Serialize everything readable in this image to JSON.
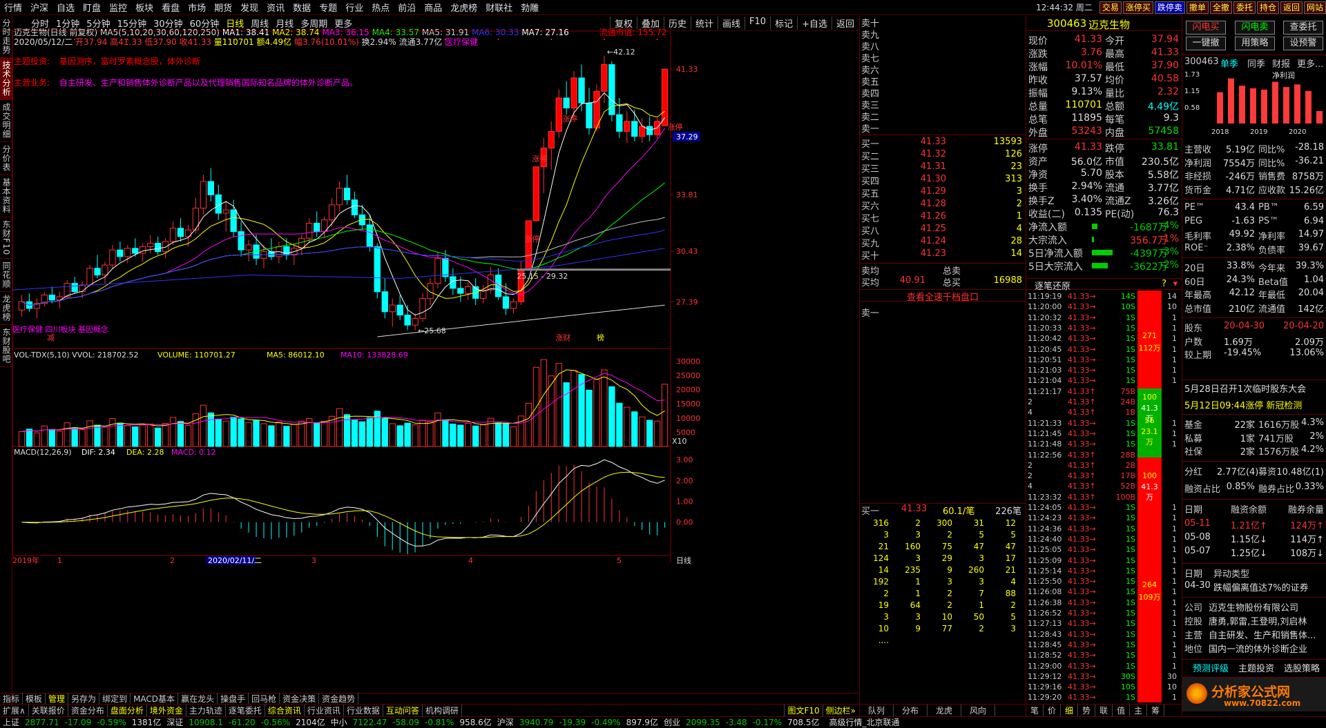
{
  "menu": [
    "行情",
    "沪深",
    "自选",
    "盯盘",
    "监控",
    "板块",
    "看盘",
    "市场",
    "期货",
    "发现",
    "资讯",
    "数据",
    "专题",
    "行业",
    "热点",
    "前沿",
    "商品",
    "龙虎榜",
    "财联社",
    "勃雕"
  ],
  "clock": "12:44:32 周二",
  "top_buttons": [
    "交易",
    "涨停买",
    "跌停卖",
    "撤单",
    "全撤",
    "委托",
    "持仓",
    "返回",
    "网站"
  ],
  "toolbar": {
    "periods": [
      "分时",
      "1分钟",
      "5分钟",
      "15分钟",
      "30分钟",
      "60分钟",
      "日线",
      "周线",
      "月线",
      "多周期",
      "更多"
    ],
    "active": "日线",
    "right": [
      "复权",
      "叠加",
      "历史",
      "统计",
      "画线",
      "F10",
      "标记",
      "+自选",
      "返回"
    ]
  },
  "left_tabs": [
    "分时走势",
    "技术分析",
    "成交明细",
    "分价表",
    "基本资料",
    "东财F10",
    "同花顺",
    "龙虎榜",
    "东财股吧"
  ],
  "active_left_tab": "技术分析",
  "info": {
    "name": "迈克生物(日线 前复权)",
    "ma_label": "MA5(5,10,20,30,60,120,250)",
    "ma1": "MA1: 38.41",
    "ma2": "MA2: 38.74",
    "ma3": "MA3: 36.15",
    "ma4": "MA4: 33.57",
    "ma5": "MA5: 31.91",
    "ma6": "MA6: 30.33",
    "ma7": "MA7: 27.16",
    "float_cap": "流通市值: 155.72",
    "date_line": "2020/05/12/二",
    "open": "开37.94",
    "high": "高41.33",
    "low": "低37.90",
    "close": "收41.33",
    "vol": "量110701",
    "amt": "额4.49亿",
    "chg": "幅3.76(10.01%)",
    "turn": "换2.94%",
    "float": "流通3.77亿",
    "sector": "医疗保健",
    "theme_label": "主题投资:",
    "theme_text": "基因测序，富时罗素概念股，体外诊断",
    "biz_label": "主营业务:",
    "biz_text": "自主研发、生产和销售体外诊断产品以及代理销售国际知名品牌的体外诊断产品。"
  },
  "price_axis": [
    "41.33",
    "37.29",
    "33.81",
    "30.43",
    "27.39"
  ],
  "chart_annotations": {
    "high": "42.12",
    "low": "25.68",
    "mid": "25.15 - 29.32",
    "zt1": "涨停",
    "zt2": "涨停",
    "zt3": "涨停",
    "zt4": "涨停",
    "bottom_tags": [
      "医疗保健",
      "四川板块",
      "基因概念"
    ],
    "mark1": "减",
    "mark2": "涨财",
    "mark3": "榜"
  },
  "vol_info": {
    "label": "VOL-TDX(5,10)",
    "vvol": "VVOL: 218702.52",
    "volume": "VOLUME: 110701.27",
    "ma5": "MA5: 86012.10",
    "ma10": "MA10: 133828.69"
  },
  "vol_axis": [
    "30000",
    "25000",
    "20000",
    "15000",
    "10000",
    "5000",
    "X10"
  ],
  "macd_info": {
    "label": "MACD(12,26,9)",
    "dif": "DIF: 2.34",
    "dea": "DEA: 2.28",
    "macd": "MACD: 0.12"
  },
  "macd_axis": [
    "3.00",
    "2.00",
    "1.00",
    "0.00"
  ],
  "x_labels": [
    "2019年",
    "1",
    "2",
    "2020/02/11/二",
    "3",
    "4",
    "5"
  ],
  "x_right": "日线",
  "bottom_tabs1": [
    "指标",
    "模板",
    "管理",
    "另存为",
    "绑定到",
    "MACD基本",
    "赢在龙头",
    "操盘手",
    "回马枪",
    "资金决策",
    "资金趋势"
  ],
  "bottom_tabs2": [
    "扩展∧",
    "关联报价",
    "资金分布",
    "盘面分析",
    "境外资金",
    "主力轨迹",
    "逐笔委托",
    "综合资讯",
    "行业资讯",
    "行业数据",
    "互动问答",
    "机构调研"
  ],
  "bottom_right": [
    "图文F10",
    "侧边栏»"
  ],
  "status": [
    {
      "k": "上证",
      "v": "2877.71",
      "c": "-17.09",
      "p": "-0.59%",
      "a": "1381亿"
    },
    {
      "k": "深证",
      "v": "10908.1",
      "c": "-61.20",
      "p": "-0.56%",
      "a": "2104亿"
    },
    {
      "k": "中小",
      "v": "7122.47",
      "c": "-58.09",
      "p": "-0.81%",
      "a": "958.6亿"
    },
    {
      "k": "沪深",
      "v": "3940.79",
      "c": "-19.39",
      "p": "-0.49%",
      "a": "897.9亿"
    },
    {
      "k": "创业",
      "v": "2099.35",
      "c": "-3.48",
      "p": "-0.17%",
      "a": "708.5亿"
    }
  ],
  "status_tail": "高级行情_北京联通",
  "orderbook": {
    "sells": [
      "卖十",
      "卖九",
      "卖八",
      "卖七",
      "卖六",
      "卖五",
      "卖四",
      "卖三",
      "卖二",
      "卖一"
    ],
    "buys": [
      {
        "l": "买一",
        "p": "41.33",
        "v": "13593"
      },
      {
        "l": "买二",
        "p": "41.32",
        "v": "126"
      },
      {
        "l": "买三",
        "p": "41.31",
        "v": "23"
      },
      {
        "l": "买四",
        "p": "41.30",
        "v": "313"
      },
      {
        "l": "买五",
        "p": "41.29",
        "v": "3"
      },
      {
        "l": "买六",
        "p": "41.28",
        "v": "2"
      },
      {
        "l": "买七",
        "p": "41.26",
        "v": "1"
      },
      {
        "l": "买八",
        "p": "41.25",
        "v": "4"
      },
      {
        "l": "买九",
        "p": "41.24",
        "v": "28"
      },
      {
        "l": "买十",
        "p": "41.23",
        "v": "14"
      }
    ],
    "sell_avg": "卖均",
    "buy_avg": "买均",
    "total_sell": "总卖",
    "total_buy": "总买",
    "buy_avg_val": "40.91",
    "total_buy_val": "16988",
    "link": "查看全速千档盘口",
    "sell1": "卖一",
    "buy1_row": {
      "l": "买一",
      "p": "41.33",
      "q": "60.1/笔",
      "n": "226笔"
    },
    "queue": [
      [
        "316",
        "2",
        "300",
        "31",
        "12"
      ],
      [
        "3",
        "3",
        "2",
        "5",
        "5"
      ],
      [
        "21",
        "160",
        "75",
        "47",
        "47"
      ],
      [
        "124",
        "3",
        "29",
        "3",
        "17"
      ],
      [
        "14",
        "235",
        "9",
        "260",
        "21"
      ],
      [
        "192",
        "1",
        "3",
        "3",
        "4"
      ],
      [
        "2",
        "1",
        "2",
        "7",
        "88"
      ],
      [
        "19",
        "64",
        "2",
        "1",
        "2"
      ],
      [
        "3",
        "3",
        "10",
        "50",
        "5"
      ],
      [
        "10",
        "9",
        "77",
        "2",
        "3"
      ],
      [
        "....",
        "",
        "",
        "",
        ""
      ]
    ],
    "bottom_tabs": [
      "队列",
      "分布",
      "龙虎",
      "风向"
    ]
  },
  "quote": {
    "code": "300463",
    "name": "迈克生物",
    "rows": [
      {
        "a": "现价",
        "b": "41.33",
        "bc": "up",
        "c": "今开",
        "d": "37.94",
        "dc": "up"
      },
      {
        "a": "涨跌",
        "b": "3.76",
        "bc": "up",
        "c": "最高",
        "d": "41.33",
        "dc": "up"
      },
      {
        "a": "涨幅",
        "b": "10.01%",
        "bc": "up",
        "c": "最低",
        "d": "37.90",
        "dc": "up"
      },
      {
        "a": "昨收",
        "b": "37.57",
        "bc": "wh",
        "c": "均价",
        "d": "40.58",
        "dc": "up"
      },
      {
        "a": "振幅",
        "b": "9.13%",
        "bc": "wh",
        "c": "量比",
        "d": "2.32",
        "dc": "up"
      },
      {
        "a": "总量",
        "b": "110701",
        "bc": "yel",
        "c": "总额",
        "d": "4.49亿",
        "dc": "cy"
      },
      {
        "a": "总笔",
        "b": "11895",
        "bc": "wh",
        "c": "每笔",
        "d": "9.3",
        "dc": "wh"
      },
      {
        "a": "外盘",
        "b": "53243",
        "bc": "up",
        "c": "内盘",
        "d": "57458",
        "dc": "dn"
      },
      {
        "a": "涨停",
        "b": "41.33",
        "bc": "up",
        "c": "跌停",
        "d": "33.81",
        "dc": "dn"
      },
      {
        "a": "资产",
        "b": "56.0亿",
        "bc": "wh",
        "c": "市值",
        "d": "230.5亿",
        "dc": "wh"
      },
      {
        "a": "净资",
        "b": "5.70",
        "bc": "wh",
        "c": "股本",
        "d": "5.58亿",
        "dc": "wh"
      },
      {
        "a": "换手",
        "b": "2.94%",
        "bc": "wh",
        "c": "流通",
        "d": "3.77亿",
        "dc": "wh"
      },
      {
        "a": "换手Z",
        "b": "3.40%",
        "bc": "wh",
        "c": "流通Z",
        "d": "3.26亿",
        "dc": "wh"
      },
      {
        "a": "收益(二)",
        "b": "0.135",
        "bc": "wh",
        "c": "PE(动)",
        "d": "76.3",
        "dc": "wh"
      }
    ],
    "flows": [
      {
        "a": "净流入额",
        "b": "-1687万",
        "d": "-4%",
        "bar": 0.15
      },
      {
        "a": "大宗流入",
        "b": "356.7万",
        "d": "1%",
        "bar": 0.05
      },
      {
        "a": "5日净流入额",
        "b": "-4397万",
        "d": "-3%",
        "bar": 0.6
      },
      {
        "a": "5日大宗流入",
        "b": "-3622万",
        "d": "-2%",
        "bar": 0.45
      }
    ],
    "tick_title": "逐笔还原",
    "ticks": [
      {
        "t": "11:19:19",
        "v": "14S",
        "n": "14"
      },
      {
        "t": "11:20:00",
        "v": "10S",
        "n": "10"
      },
      {
        "t": "11:20:32",
        "v": "1S",
        "n": "1"
      },
      {
        "t": "11:20:33",
        "v": "1S",
        "n": "1"
      },
      {
        "t": "11:20:42",
        "v": "1S",
        "n": "1"
      },
      {
        "t": "11:20:45",
        "v": "1S",
        "n": "1"
      },
      {
        "t": "11:20:51",
        "v": "1S",
        "n": "1"
      },
      {
        "t": "11:21:03",
        "v": "1S",
        "n": "1"
      },
      {
        "t": "11:21:04",
        "v": "1S",
        "n": "1"
      },
      {
        "t": "11:21:17",
        "v": "75B",
        "n": ""
      },
      {
        "t": "2",
        "v": "24B",
        "n": ""
      },
      {
        "t": "4",
        "v": "1B",
        "n": ""
      },
      {
        "t": "11:21:33",
        "v": "1S",
        "n": "1"
      },
      {
        "t": "11:21:45",
        "v": "1S",
        "n": "1"
      },
      {
        "t": "11:21:48",
        "v": "1S",
        "n": "1"
      },
      {
        "t": "11:22:56",
        "v": "28B",
        "n": ""
      },
      {
        "t": "2",
        "v": "2B",
        "n": ""
      },
      {
        "t": "2",
        "v": "17B",
        "n": ""
      },
      {
        "t": "4",
        "v": "52B",
        "n": ""
      },
      {
        "t": "11:23:32",
        "v": "100B",
        "n": ""
      },
      {
        "t": "11:24:05",
        "v": "1S",
        "n": "1"
      },
      {
        "t": "11:24:23",
        "v": "1S",
        "n": "1"
      },
      {
        "t": "11:24:36",
        "v": "1S",
        "n": "1"
      },
      {
        "t": "11:24:40",
        "v": "1S",
        "n": "1"
      },
      {
        "t": "11:25:05",
        "v": "1S",
        "n": "1"
      },
      {
        "t": "11:25:09",
        "v": "1S",
        "n": "1"
      },
      {
        "t": "11:25:14",
        "v": "1S",
        "n": "1"
      },
      {
        "t": "11:25:50",
        "v": "1S",
        "n": "1"
      },
      {
        "t": "11:26:08",
        "v": "1S",
        "n": "1"
      },
      {
        "t": "11:26:38",
        "v": "1S",
        "n": "1"
      },
      {
        "t": "11:26:52",
        "v": "1S",
        "n": "1"
      },
      {
        "t": "11:27:13",
        "v": "1S",
        "n": "1"
      },
      {
        "t": "11:28:43",
        "v": "1S",
        "n": "1"
      },
      {
        "t": "11:28:45",
        "v": "1S",
        "n": "1"
      },
      {
        "t": "11:28:52",
        "v": "1S",
        "n": "1"
      },
      {
        "t": "11:29:00",
        "v": "1S",
        "n": "1"
      },
      {
        "t": "11:29:12",
        "v": "30S",
        "n": "30"
      },
      {
        "t": "11:29:16",
        "v": "10S",
        "n": "10"
      },
      {
        "t": "11:29:20",
        "v": "1S",
        "n": "1"
      }
    ],
    "tick_price": "41.33",
    "tick_marks": [
      "271",
      "112万",
      "100",
      "41.3万",
      "56",
      "23.1万",
      "100",
      "41.3万",
      "264",
      "109万"
    ],
    "bottom_tabs": [
      "笔",
      "价",
      "细",
      "势",
      "联",
      "值",
      "主",
      "筹"
    ]
  },
  "fin": {
    "buttons": [
      "闪电买",
      "闪电卖",
      "查委托",
      "一键撤",
      "用策略",
      "设预警"
    ],
    "tabs": {
      "code": "300463",
      "t1": "单季",
      "t2": "同季",
      "t3": "财报",
      "t4": "更多..."
    },
    "chart_data": {
      "type": "bar",
      "categories": [
        "2018",
        "2019",
        "2020"
      ],
      "title": "净利润",
      "values": [
        1.2,
        1.73,
        1.45,
        1.35,
        1.3,
        1.6,
        1.4,
        1.5,
        1.25,
        0.48
      ],
      "ylabels": [
        "1.73",
        "1.15",
        "0.58"
      ],
      "xlabels": [
        "2018",
        "2019",
        "2020"
      ]
    },
    "rows1": [
      {
        "a": "主营收",
        "b": "5.19亿",
        "c": "同比%",
        "d": "-28.18"
      },
      {
        "a": "净利润",
        "b": "7554万",
        "c": "同比%",
        "d": "-36.21"
      },
      {
        "a": "非经损",
        "b": "-246万",
        "c": "销售费",
        "d": "8758万"
      },
      {
        "a": "货币金",
        "b": "4.71亿",
        "c": "应收款",
        "d": "15.26亿"
      }
    ],
    "rows2": [
      {
        "a": "PE™",
        "b": "43.4",
        "c": "PB™",
        "d": "6.59"
      },
      {
        "a": "PEG",
        "b": "-1.63",
        "c": "PS™",
        "d": "6.94"
      },
      {
        "a": "毛利率",
        "b": "49.92",
        "c": "净利率",
        "d": "14.97"
      },
      {
        "a": "ROE⁻",
        "b": "2.38%",
        "c": "负债率",
        "d": "39.67"
      }
    ],
    "rows3": [
      {
        "a": "20日",
        "b": "33.8%",
        "c": "今年来",
        "d": "39.3%"
      },
      {
        "a": "60日",
        "b": "24.3%",
        "c": "Beta值",
        "d": "1.04"
      },
      {
        "a": "年最高",
        "b": "42.12",
        "c": "年最低",
        "d": "20.04"
      },
      {
        "a": "总市值",
        "b": "210亿",
        "c": "流通值",
        "d": "142亿"
      }
    ],
    "holders": [
      {
        "a": "股东",
        "b": "20-04-30",
        "d": "20-04-20",
        "bc": "up",
        "dc": "up"
      },
      {
        "a": "户数",
        "b": "1.69万",
        "d": "2.09万",
        "bc": "wh",
        "dc": "wh"
      },
      {
        "a": "较上期",
        "b": "-19.45%",
        "d": "13.06%",
        "bc": "wh",
        "dc": "wh"
      }
    ],
    "news1": "5月28日召开1次临时股东大会",
    "news2": "5月12日09:44涨停 新冠检测",
    "funds": [
      {
        "a": "基金",
        "b": "22家",
        "c": "1616万股",
        "d": "4.3%"
      },
      {
        "a": "私募",
        "b": "1家",
        "c": "741万股",
        "d": "2%"
      },
      {
        "a": "社保",
        "b": "2家",
        "c": "1576万股",
        "d": "4.2%"
      }
    ],
    "div": {
      "a": "分红",
      "b": "2.77亿(4)",
      "c": "募资",
      "d": "10.48亿(1)"
    },
    "margin": {
      "a": "融资占比",
      "b": "0.85%",
      "c": "融券占比",
      "d": "0.33%"
    },
    "margin_head": {
      "a": "日期",
      "b": "融资余额",
      "c": "融券余量"
    },
    "margin_rows": [
      {
        "a": "05-11",
        "b": "1.21亿↑",
        "c": "124万↑",
        "col": "up"
      },
      {
        "a": "05-08",
        "b": "1.15亿↓",
        "c": "114万↑",
        "col": "wh"
      },
      {
        "a": "05-07",
        "b": "1.25亿↓",
        "c": "108万↓",
        "col": "wh"
      }
    ],
    "abn_head": {
      "a": "日期",
      "b": "异动类型"
    },
    "abn_row": {
      "a": "04-30",
      "b": "跌幅偏离值达7%的证券"
    },
    "company": [
      {
        "a": "公司",
        "b": "迈克生物股份有限公司"
      },
      {
        "a": "控股",
        "b": "唐勇,郭雷,王登明,刘启林"
      },
      {
        "a": "主营",
        "b": "自主研发、生产和销售体..."
      },
      {
        "a": "地位",
        "b": "国内一流的体外诊断企业"
      }
    ],
    "foot": [
      "预测评级",
      "主题投资",
      "选股策略"
    ],
    "logo": "分析家公式网",
    "logo_url": "www.70822.com"
  },
  "colors": {
    "up": "#ff3232",
    "down": "#00ffff",
    "bg": "#000000",
    "grid": "#800000",
    "ma1": "#ffffff",
    "ma2": "#ffff00",
    "ma3": "#ff00ff",
    "ma4": "#00ff00",
    "ma5": "#ffffff",
    "ma6": "#0000ff",
    "ma7": "#ffffff"
  }
}
